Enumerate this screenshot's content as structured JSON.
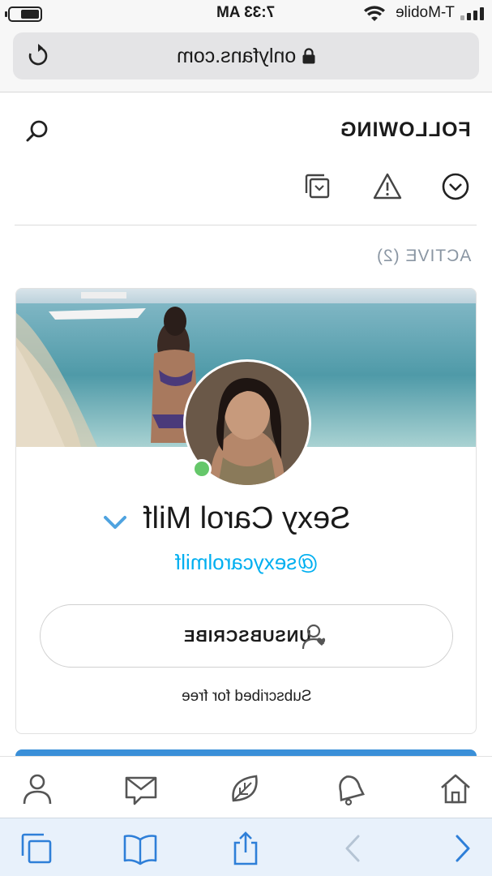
{
  "status_bar": {
    "time": "7:33 AM",
    "carrier": "T-Mobile",
    "icons": [
      "battery-icon",
      "wifi-icon",
      "signal-icon"
    ]
  },
  "browser": {
    "url": "onlyfans.com",
    "icons": [
      "reload-icon",
      "lock-icon"
    ]
  },
  "header": {
    "title": "FOLLOWING",
    "search_icon": "search-icon"
  },
  "tabs": [
    {
      "icon": "chevron-circle-icon",
      "active": true
    },
    {
      "icon": "warning-icon",
      "active": false
    },
    {
      "icon": "collection-icon",
      "active": false
    }
  ],
  "section": {
    "label": "ACTIVE (2)"
  },
  "creator": {
    "name": "Sexy Carol Milf",
    "handle": "@sexycarolmilf",
    "verified": true,
    "online": true,
    "button_label": "UNSUBSCRIBE",
    "subscription_note": "Subscribed for free"
  },
  "bottom_nav": [
    {
      "icon": "home-icon"
    },
    {
      "icon": "bell-icon"
    },
    {
      "icon": "leaf-icon"
    },
    {
      "icon": "message-icon"
    },
    {
      "icon": "profile-icon"
    }
  ],
  "safari_toolbar": [
    {
      "icon": "forward-icon"
    },
    {
      "icon": "back-icon"
    },
    {
      "icon": "share-icon"
    },
    {
      "icon": "bookmarks-icon"
    },
    {
      "icon": "tabs-icon"
    }
  ],
  "colors": {
    "accent": "#00aff0",
    "online": "#65c76a",
    "muted": "#8a96a3",
    "toolbar_blue": "#2e7fd8"
  }
}
